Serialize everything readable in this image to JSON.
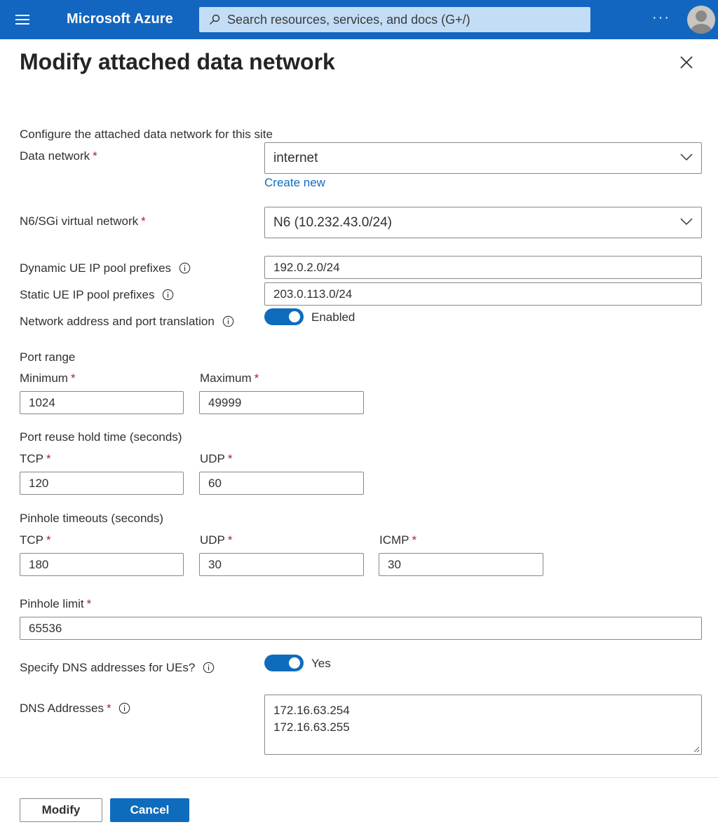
{
  "header": {
    "brand": "Microsoft Azure",
    "search_placeholder": "Search resources, services, and docs (G+/)",
    "more_label": "···",
    "menu_icon": "hamburger-icon",
    "search_icon": "search-icon",
    "avatar_icon": "user-avatar-icon"
  },
  "panel": {
    "title": "Modify attached data network",
    "close_icon": "close-icon",
    "intro": "Configure the attached data network for this site"
  },
  "form": {
    "data_network": {
      "label": "Data network",
      "required": "*",
      "value": "internet",
      "create_new": "Create new"
    },
    "virtual_network": {
      "label": "N6/SGi virtual network",
      "required": "*",
      "value": "N6 (10.232.43.0/24)"
    },
    "dynamic_pool": {
      "label": "Dynamic UE IP pool prefixes",
      "value": "192.0.2.0/24"
    },
    "static_pool": {
      "label": "Static UE IP pool prefixes",
      "value": "203.0.113.0/24"
    },
    "napt": {
      "label": "Network address and port translation",
      "toggle_on": true,
      "state": "Enabled"
    },
    "port_range": {
      "heading": "Port range",
      "minimum": {
        "label": "Minimum",
        "required": "*",
        "value": "1024"
      },
      "maximum": {
        "label": "Maximum",
        "required": "*",
        "value": "49999"
      }
    },
    "port_reuse": {
      "heading": "Port reuse hold time (seconds)",
      "tcp": {
        "label": "TCP",
        "required": "*",
        "value": "120"
      },
      "udp": {
        "label": "UDP",
        "required": "*",
        "value": "60"
      }
    },
    "pinhole_timeouts": {
      "heading": "Pinhole timeouts (seconds)",
      "tcp": {
        "label": "TCP",
        "required": "*",
        "value": "180"
      },
      "udp": {
        "label": "UDP",
        "required": "*",
        "value": "30"
      },
      "icmp": {
        "label": "ICMP",
        "required": "*",
        "value": "30"
      }
    },
    "pinhole_limit": {
      "label": "Pinhole limit",
      "required": "*",
      "value": "65536"
    },
    "specify_dns": {
      "label": "Specify DNS addresses for UEs?",
      "toggle_on": true,
      "state": "Yes"
    },
    "dns_addresses": {
      "label": "DNS Addresses",
      "required": "*",
      "lines": [
        "172.16.63.254",
        "172.16.63.255"
      ]
    }
  },
  "footer": {
    "modify_label": "Modify",
    "cancel_label": "Cancel"
  },
  "colors": {
    "topbar": "#1266c0",
    "accent": "#0f6cbd",
    "required": "#a4262c"
  }
}
